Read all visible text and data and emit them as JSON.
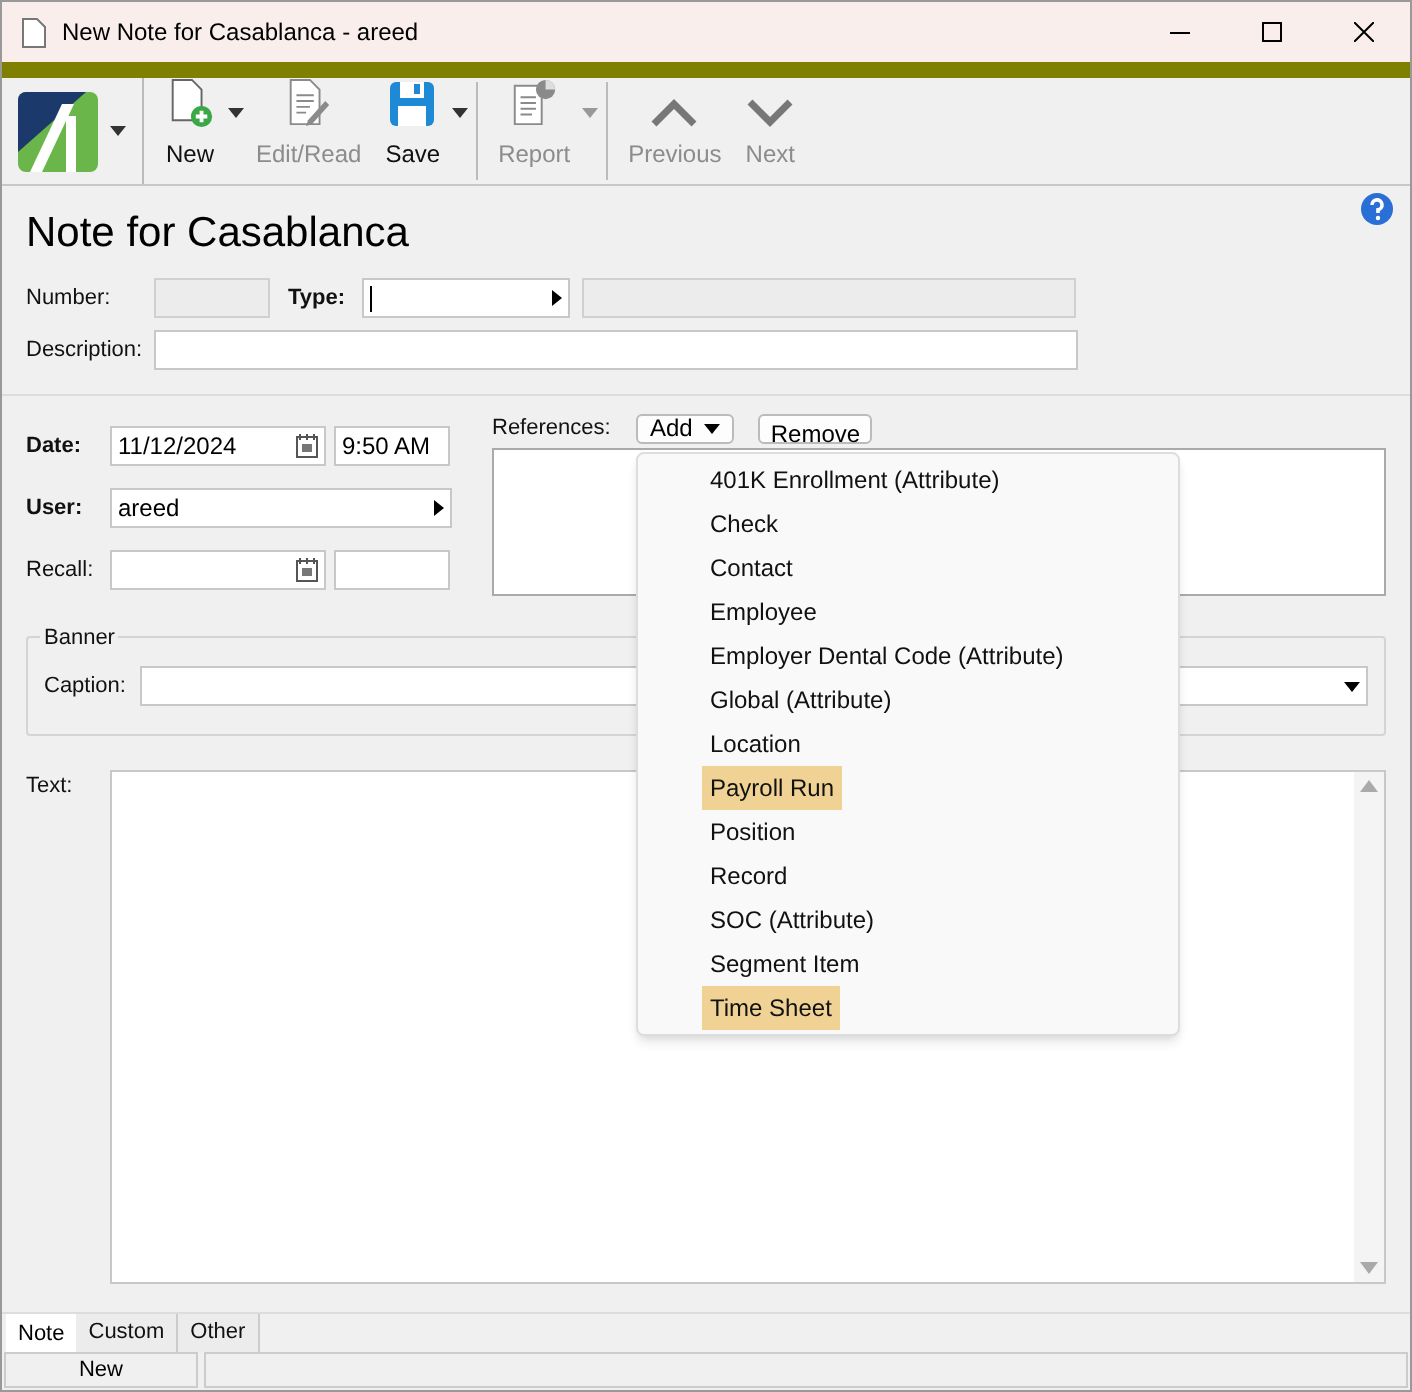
{
  "window": {
    "title": "New Note for Casablanca - areed"
  },
  "toolbar": [
    {
      "kind": "logo"
    },
    {
      "kind": "button",
      "label": "New",
      "disabled": false,
      "menu": true
    },
    {
      "kind": "button",
      "label": "Edit/Read",
      "disabled": true,
      "menu": false
    },
    {
      "kind": "button",
      "label": "Save",
      "disabled": false,
      "menu": true
    },
    {
      "kind": "separator"
    },
    {
      "kind": "button",
      "label": "Report",
      "disabled": true,
      "menu": true
    },
    {
      "kind": "separator"
    },
    {
      "kind": "button",
      "label": "Previous",
      "disabled": true,
      "menu": false
    },
    {
      "kind": "button",
      "label": "Next",
      "disabled": true,
      "menu": false
    }
  ],
  "heading": "Note for Casablanca",
  "number": {
    "label": "Number:"
  },
  "type": {
    "label": "Type:"
  },
  "description": {
    "label": "Description:"
  },
  "date": {
    "label": "Date:",
    "value": "11/12/2024",
    "time": "9:50 AM"
  },
  "user": {
    "label": "User:",
    "value": "areed"
  },
  "recall": {
    "label": "Recall:"
  },
  "references": {
    "label": "References:",
    "add": "Add",
    "remove": "Remove"
  },
  "banner": {
    "title": "Banner",
    "caption_label": "Caption:"
  },
  "text": {
    "label": "Text:"
  },
  "menu": [
    {
      "label": "401K Enrollment (Attribute)",
      "selected": false
    },
    {
      "label": "Check",
      "selected": false
    },
    {
      "label": "Contact",
      "selected": false
    },
    {
      "label": "Employee",
      "selected": false
    },
    {
      "label": "Employer Dental Code (Attribute)",
      "selected": false
    },
    {
      "label": "Global (Attribute)",
      "selected": false
    },
    {
      "label": "Location",
      "selected": false
    },
    {
      "label": "Payroll Run",
      "selected": true
    },
    {
      "label": "Position",
      "selected": false
    },
    {
      "label": "Record",
      "selected": false
    },
    {
      "label": "SOC (Attribute)",
      "selected": false
    },
    {
      "label": "Segment Item",
      "selected": false
    },
    {
      "label": "Time Sheet",
      "selected": true
    }
  ],
  "tabs": [
    {
      "label": "Note",
      "selected": true
    },
    {
      "label": "Custom",
      "selected": false
    },
    {
      "label": "Other",
      "selected": false
    }
  ],
  "status_bar": [
    "New"
  ]
}
